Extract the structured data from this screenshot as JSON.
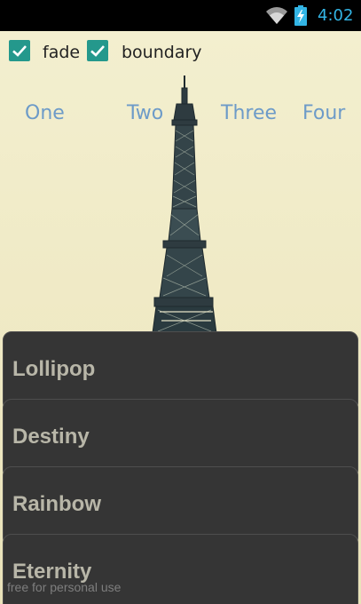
{
  "status_bar": {
    "time": "4:02",
    "icons": [
      "wifi-icon",
      "battery-charging-icon"
    ],
    "accent_color": "#33b5e5"
  },
  "toolbar": {
    "checkboxes": [
      {
        "label": "fade",
        "checked": true
      },
      {
        "label": "boundary",
        "checked": true
      }
    ],
    "checkbox_color": "#2aa198"
  },
  "tabs": [
    {
      "label": "One"
    },
    {
      "label": "Two"
    },
    {
      "label": "Three"
    },
    {
      "label": "Four"
    }
  ],
  "list": {
    "items": [
      {
        "label": "Lollipop"
      },
      {
        "label": "Destiny"
      },
      {
        "label": "Rainbow"
      },
      {
        "label": "Eternity"
      }
    ]
  },
  "watermark": "free for personal use"
}
